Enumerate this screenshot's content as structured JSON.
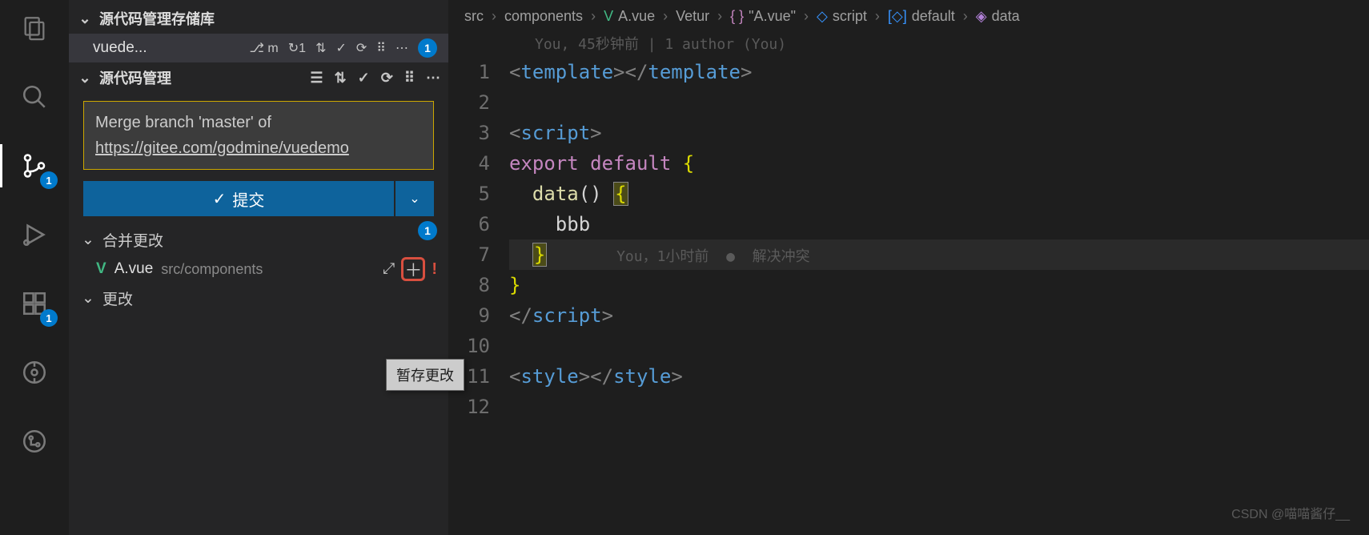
{
  "activityBar": {
    "explorerBadge": "",
    "searchBadge": "",
    "scmBadge": "1",
    "extBadge": "1"
  },
  "sidebar": {
    "repoSection": "源代码管理存储库",
    "repoName": "vuede...",
    "repoBranchIcon": "m",
    "repoSync": "1",
    "repoBadge": "1",
    "scmSection": "源代码管理",
    "commitMsg1": "Merge branch 'master' of ",
    "commitMsgUrl": "https://gitee.com/godmine/vuedemo",
    "commitBtn": "提交",
    "checkIcon": "✓",
    "mergeGroup": "合并更改",
    "mergeBadge": "1",
    "changesGroup": "更改",
    "file": {
      "name": "A.vue",
      "path": "src/components",
      "conflict": "!"
    },
    "tooltip": "暂存更改"
  },
  "breadcrumb": {
    "i0": "src",
    "i1": "components",
    "i2": "A.vue",
    "i3": "Vetur",
    "i4": "\"A.vue\"",
    "i5": "script",
    "i6": "default",
    "i7": "data"
  },
  "blameTop": "You, 45秒钟前 | 1 author (You)",
  "inlineBlame": "You，1小时前  ●  解决冲突",
  "code": {
    "l1_a": "<",
    "l1_b": "template",
    "l1_c": "></",
    "l1_d": "template",
    "l1_e": ">",
    "l3_a": "<",
    "l3_b": "script",
    "l3_c": ">",
    "l4_a": "export",
    "l4_b": " default ",
    "l4_c": "{",
    "l5_a": "  ",
    "l5_b": "data",
    "l5_c": "() ",
    "l5_d": "{",
    "l6_a": "    bbb",
    "l7_a": "  ",
    "l7_b": "}",
    "l8_a": "}",
    "l9_a": "</",
    "l9_b": "script",
    "l9_c": ">",
    "l11_a": "<",
    "l11_b": "style",
    "l11_c": "></",
    "l11_d": "style",
    "l11_e": ">"
  },
  "lineNumbers": [
    "1",
    "2",
    "3",
    "4",
    "5",
    "6",
    "7",
    "8",
    "9",
    "10",
    "11",
    "12"
  ],
  "watermark": "CSDN @喵喵酱仔__"
}
